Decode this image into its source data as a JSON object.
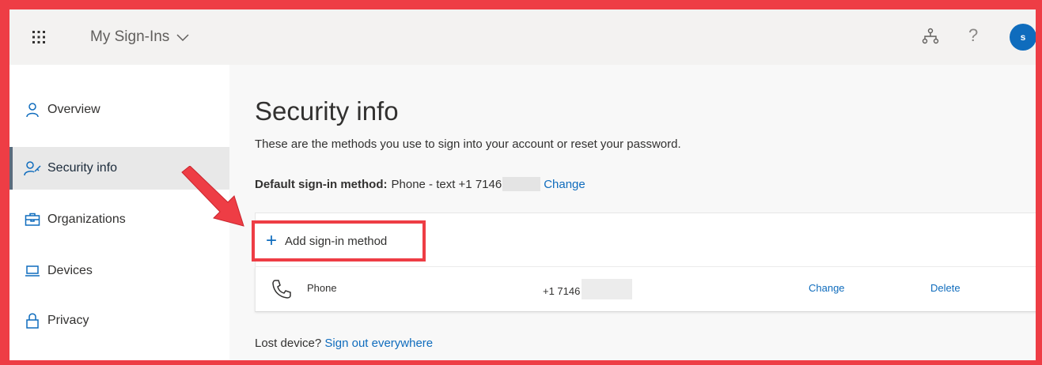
{
  "header": {
    "app_title": "My Sign-Ins",
    "help_label": "?",
    "avatar_initial": "s"
  },
  "sidebar": {
    "items": [
      {
        "label": "Overview",
        "icon": "person-icon",
        "active": false
      },
      {
        "label": "Security info",
        "icon": "security-person-icon",
        "active": true
      },
      {
        "label": "Organizations",
        "icon": "briefcase-icon",
        "active": false
      },
      {
        "label": "Devices",
        "icon": "laptop-icon",
        "active": false
      },
      {
        "label": "Privacy",
        "icon": "lock-icon",
        "active": false
      }
    ]
  },
  "main": {
    "title": "Security info",
    "subtitle": "These are the methods you use to sign into your account or reset your password.",
    "default_method": {
      "label": "Default sign-in method:",
      "value": "Phone - text +1 7146",
      "change_label": "Change"
    },
    "add_method_label": "Add sign-in method",
    "methods": [
      {
        "type": "Phone",
        "value": "+1 7146",
        "change_label": "Change",
        "delete_label": "Delete"
      }
    ],
    "lost_device": {
      "text": "Lost device?",
      "link": "Sign out everywhere"
    }
  },
  "colors": {
    "accent": "#0f6cbd",
    "highlight_border": "#ee3d45",
    "active_bar": "#5b6b7d"
  }
}
